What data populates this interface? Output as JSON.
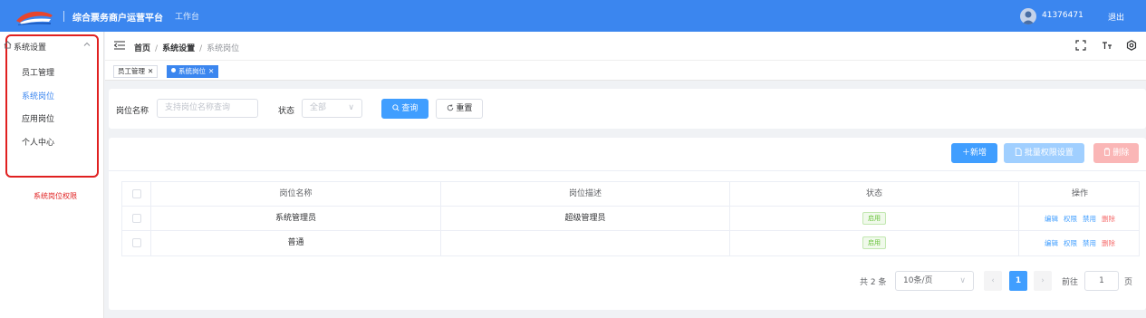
{
  "header": {
    "brand_title": "综合票务商户运营平台",
    "workbench": "工作台",
    "user_id": "41376471",
    "logout": "退出"
  },
  "sidebar": {
    "group_label": "系统设置",
    "items": [
      {
        "label": "员工管理",
        "active": false
      },
      {
        "label": "系统岗位",
        "active": true
      },
      {
        "label": "应用岗位",
        "active": false
      },
      {
        "label": "个人中心",
        "active": false
      }
    ],
    "note": "系统岗位权限"
  },
  "breadcrumb": {
    "items": [
      "首页",
      "系统设置",
      "系统岗位"
    ]
  },
  "tags": [
    {
      "label": "员工管理",
      "active": false
    },
    {
      "label": "系统岗位",
      "active": true
    }
  ],
  "search": {
    "name_label": "岗位名称",
    "name_placeholder": "支持岗位名称查询",
    "status_label": "状态",
    "status_value": "全部",
    "query_label": "查询",
    "reset_label": "重置"
  },
  "toolbar": {
    "add_label": "新增",
    "batch_label": "批量权限设置",
    "delete_label": "删除"
  },
  "table": {
    "columns": [
      "岗位名称",
      "岗位描述",
      "状态",
      "操作"
    ],
    "rows": [
      {
        "name": "系统管理员",
        "desc": "超级管理员",
        "status": "启用",
        "ops": [
          "编辑",
          "权限",
          "禁用",
          "删除"
        ]
      },
      {
        "name": "普通",
        "desc": "",
        "status": "启用",
        "ops": [
          "编辑",
          "权限",
          "禁用",
          "删除"
        ]
      }
    ]
  },
  "pagination": {
    "total": "共 2 条",
    "page_size": "10条/页",
    "current_page": "1",
    "goto_label": "前往",
    "goto_value": "1",
    "page_suffix": "页"
  },
  "colors": {
    "header_bg": "#3b86ef",
    "primary": "#409eff",
    "danger": "#f56c6c",
    "success": "#67c23a",
    "highlight_border": "#e02020"
  }
}
